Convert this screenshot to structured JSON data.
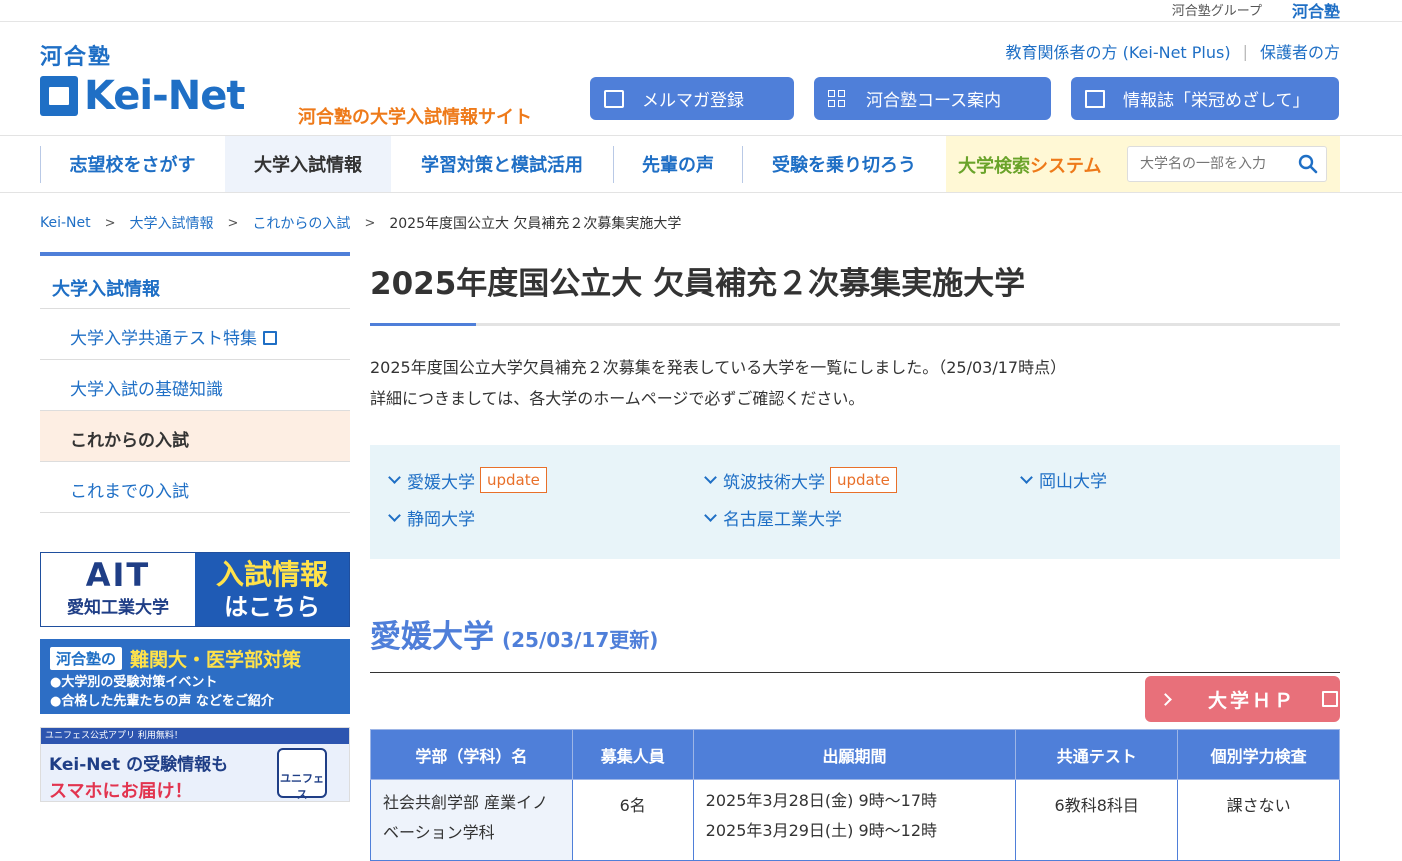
{
  "group": {
    "label": "河合塾グループ",
    "logo": "河合塾"
  },
  "header": {
    "logo_top": "河合塾",
    "logo_main": "Kei-Net",
    "tagline": "河合塾の大学入試情報サイト",
    "link_plus": "教育関係者の方 (Kei-Net Plus)",
    "link_parents": "保護者の方",
    "btn_mailmag": "メルマガ登録",
    "btn_course": "河合塾コース案内",
    "btn_magazine": "情報誌「栄冠めざして」"
  },
  "nav": {
    "items": [
      "志望校をさがす",
      "大学入試情報",
      "学習対策と模試活用",
      "先輩の声",
      "受験を乗り切ろう"
    ],
    "search_label_a": "大学検索",
    "search_label_b": "システム",
    "search_placeholder": "大学名の一部を入力"
  },
  "breadcrumb": [
    "Kei-Net",
    "大学入試情報",
    "これからの入試",
    "2025年度国公立大 欠員補充２次募集実施大学"
  ],
  "sidebar": {
    "heading": "大学入試情報",
    "items": [
      "大学入学共通テスト特集",
      "大学入試の基礎知識",
      "これからの入試",
      "これまでの入試"
    ]
  },
  "banners": {
    "b1_logo": "AIT",
    "b1_name": "愛知工業大学",
    "b1_t1": "入試情報",
    "b1_t2": "はこちら",
    "b2_tag": "河合塾の",
    "b2_head": "難関大・医学部対策",
    "b2_l1": "●大学別の受験対策イベント",
    "b2_l2": "●合格した先輩たちの声 などをご紹介",
    "b3_strip": "ユニフェス公式アプリ 利用無料！",
    "b3_t1": "Kei-Net の受験情報も",
    "b3_t2": "スマホにお届け！",
    "b3_badge": "ユニフェス"
  },
  "main": {
    "title": "2025年度国公立大 欠員補充２次募集実施大学",
    "intro1": "2025年度国公立大学欠員補充２次募集を発表している大学を一覧にしました。（25/03/17時点）",
    "intro2": "詳細につきましては、各大学のホームページで必ずご確認ください。",
    "update_label": "update",
    "toc": [
      "愛媛大学",
      "筑波技術大学",
      "岡山大学",
      "静岡大学",
      "名古屋工業大学"
    ],
    "section_name": "愛媛大学",
    "section_date": "(25/03/17更新)",
    "hp_button": "大学ＨＰ",
    "table": {
      "headers": [
        "学部（学科）名",
        "募集人員",
        "出願期間",
        "共通テスト",
        "個別学力検査"
      ],
      "row1": {
        "dept": "社会共創学部 産業イノベーション学科",
        "capacity": "6名",
        "period1": "2025年3月28日(金) 9時～17時",
        "period2": "2025年3月29日(土) 9時～12時",
        "common_test": "6教科8科目",
        "individual": "課さない"
      }
    }
  },
  "colors": {
    "brand_blue": "#1f6fc5",
    "accent_orange": "#ee7a1a",
    "button_blue": "#4f7fd9",
    "hp_pink": "#e8707a"
  }
}
